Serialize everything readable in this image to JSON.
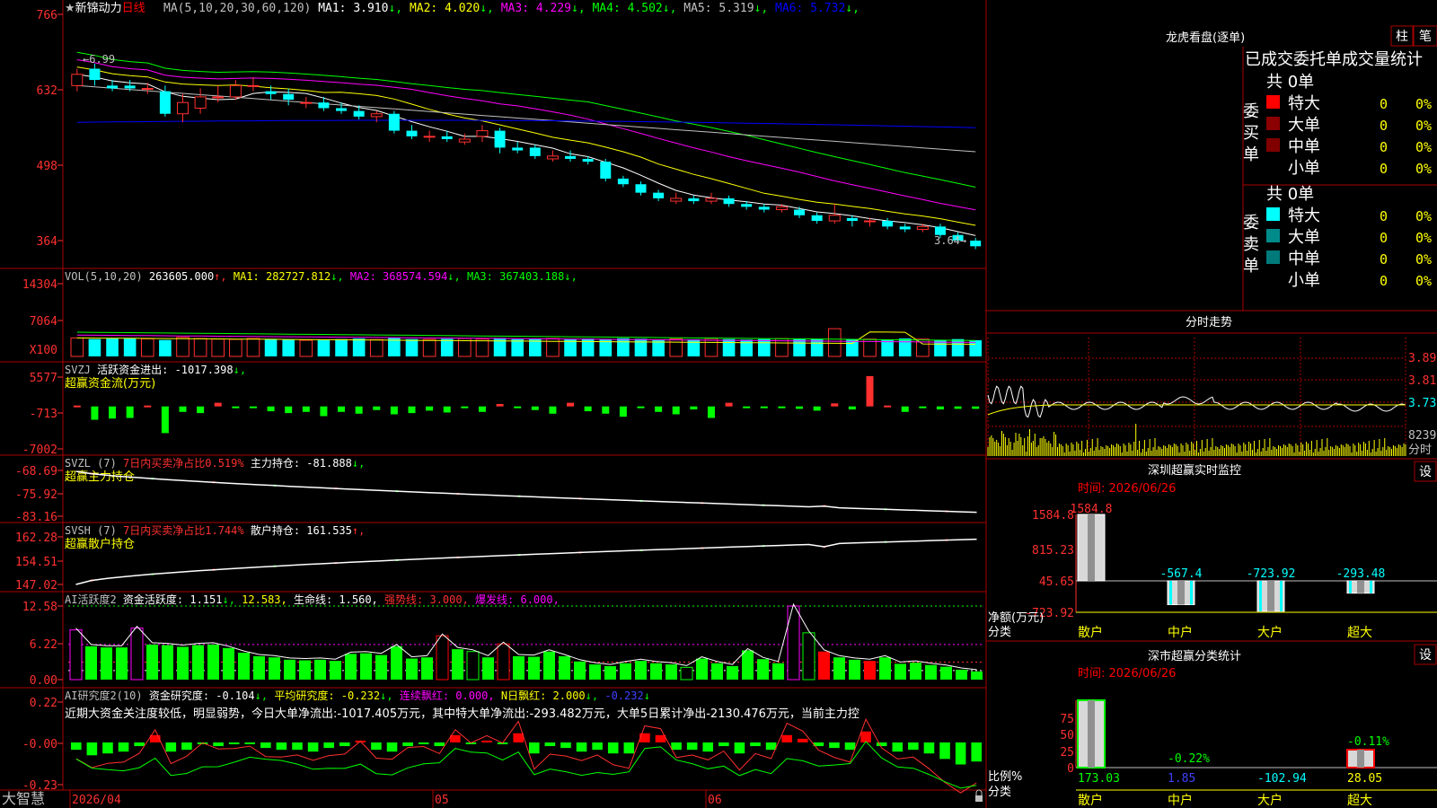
{
  "app": {
    "brand": "大智慧",
    "star": "★",
    "stock_name": "新锦动力",
    "period": "日线"
  },
  "main": {
    "ma_label": "MA(5,10,20,30,60,120)",
    "ma_values": [
      {
        "label": "MA1:",
        "value": "3.910",
        "dir": "↓",
        "color": "#ffffff"
      },
      {
        "label": "MA2:",
        "value": "4.020",
        "dir": "↓",
        "color": "#ffff00"
      },
      {
        "label": "MA3:",
        "value": "4.229",
        "dir": "↓",
        "color": "#ff00ff"
      },
      {
        "label": "MA4:",
        "value": "4.502",
        "dir": "↓",
        "color": "#00ff00"
      },
      {
        "label": "MA5:",
        "value": "5.319",
        "dir": "↓",
        "color": "#c0c0c0"
      },
      {
        "label": "MA6:",
        "value": "5.732",
        "dir": "↓",
        "color": "#0000ff"
      }
    ],
    "y_ticks": [
      "766",
      "632",
      "498",
      "364"
    ],
    "high_marker": "←6.99",
    "low_marker": "3.64→"
  },
  "vol": {
    "label": "VOL(5,10,20)",
    "value": "263605.000",
    "value_dir": "↑",
    "items": [
      {
        "label": "MA1:",
        "value": "282727.812",
        "dir": "↓",
        "color": "#ffff00"
      },
      {
        "label": "MA2:",
        "value": "368574.594",
        "dir": "↓",
        "color": "#ff00ff"
      },
      {
        "label": "MA3:",
        "value": "367403.188",
        "dir": "↓",
        "color": "#00ff00"
      }
    ],
    "y_ticks": [
      "14304",
      "7064"
    ],
    "unit": "X100"
  },
  "svzj": {
    "label": "SVZJ",
    "text1": "活跃资金进出:",
    "value": "-1017.398",
    "value_dir": "↓",
    "subtitle": "超赢资金流(万元)",
    "y_ticks": [
      "5577",
      "-713",
      "-7002"
    ]
  },
  "svzl": {
    "label": "SVZL (7)",
    "text1": "7日内买卖净占比0.519%",
    "text2": "主力持仓:",
    "value": "-81.888",
    "value_dir": "↓",
    "subtitle": "超赢主力持仓",
    "y_ticks": [
      "-68.69",
      "-75.92",
      "-83.16"
    ]
  },
  "svsh": {
    "label": "SVSH (7)",
    "text1": "7日内买卖净占比1.744%",
    "text2": "散户持仓:",
    "value": "161.535",
    "value_dir": "↑",
    "subtitle": "超赢散户持仓",
    "y_ticks": [
      "162.28",
      "154.51",
      "147.02"
    ]
  },
  "ai_active": {
    "label": "AI活跃度2",
    "text1": "资金活跃度:",
    "value1": "1.151",
    "value1_dir": "↓",
    "value2": "12.583",
    "text3": "生命线:",
    "value3": "1.560",
    "text4": "强势线:",
    "value4": "3.000",
    "text5": "爆发线:",
    "value5": "6.000",
    "y_ticks": [
      "12.58",
      "6.22",
      "0.00"
    ]
  },
  "ai_research": {
    "label": "AI研究度2(10)",
    "text1": "资金研究度:",
    "value1": "-0.104",
    "value1_dir": "↓",
    "text2": "平均研究度:",
    "value2": "-0.232",
    "value2_dir": "↓",
    "text3": "连续飘红:",
    "value3": "0.000",
    "text4": "N日飘红:",
    "value4": "2.000",
    "value4_dir": "↓",
    "value5": "-0.232",
    "value5_dir": "↓",
    "comment": "近期大资金关注度较低，明显弱势，今日大单净流出:-1017.405万元，其中特大单净流出:-293.482万元，大单5日累计净出-2130.476万元，当前主力控",
    "y_ticks": [
      "0.22",
      "-0.00",
      "-0.23"
    ]
  },
  "x_axis": {
    "labels": [
      "2026/04",
      "05",
      "06"
    ]
  },
  "lhb": {
    "title": "龙虎看盘(逐单)",
    "btn1": "柱",
    "btn2": "笔",
    "subtitle": "已成交委托单成交量统计",
    "buy_label": "委买单",
    "sell_label": "委卖单",
    "buy_total": "共 0单",
    "sell_total": "共 0单",
    "buy_rows": [
      {
        "name": "特大",
        "count": "0",
        "pct": "0%",
        "color": "#ff0000"
      },
      {
        "name": "大单",
        "count": "0",
        "pct": "0%",
        "color": "#8b0000"
      },
      {
        "name": "中单",
        "count": "0",
        "pct": "0%",
        "color": "#800000"
      },
      {
        "name": "小单",
        "count": "0",
        "pct": "0%",
        "color": ""
      }
    ],
    "sell_rows": [
      {
        "name": "特大",
        "count": "0",
        "pct": "0%",
        "color": "#00ffff"
      },
      {
        "name": "大单",
        "count": "0",
        "pct": "0%",
        "color": "#008b8b"
      },
      {
        "name": "中单",
        "count": "0",
        "pct": "0%",
        "color": "#007a7a"
      },
      {
        "name": "小单",
        "count": "0",
        "pct": "0%",
        "color": ""
      }
    ]
  },
  "fenshi": {
    "title": "分时走势",
    "price_ticks": [
      "3.890",
      "3.810",
      "3.730"
    ],
    "vol_tick": "8239",
    "unit": "分时"
  },
  "sz_monitor": {
    "title": "深圳超赢实时监控",
    "btn": "设",
    "time": "时间: 2026/06/26",
    "y_ticks": [
      "1584.8",
      "815.23",
      "45.65",
      "-723.92"
    ],
    "axis_label1": "净额(万元)",
    "axis_label2": "分类",
    "bars": [
      {
        "name": "散户",
        "value": 1584.8,
        "label": "1584.8"
      },
      {
        "name": "中户",
        "value": -567.4,
        "label": "-567.4"
      },
      {
        "name": "大户",
        "value": -723.92,
        "label": "-723.92"
      },
      {
        "name": "超大",
        "value": -293.48,
        "label": "-293.48"
      }
    ]
  },
  "sz_class": {
    "title": "深市超赢分类统计",
    "btn": "设",
    "time": "时间: 2026/06/26",
    "y_ticks": [
      "75",
      "50",
      "25",
      "0"
    ],
    "axis_label1": "比例%",
    "axis_label2": "分类",
    "bars": [
      {
        "name": "散户",
        "value": 75,
        "top_label": "",
        "bottom_label": "173.03",
        "bottom_color": "#00ff00"
      },
      {
        "name": "中户",
        "value": 0,
        "top_label": "-0.22%",
        "bottom_label": "1.85",
        "bottom_color": "#4040ff"
      },
      {
        "name": "大户",
        "value": 0,
        "top_label": "",
        "bottom_label": "-102.94",
        "bottom_color": "#00ffff"
      },
      {
        "name": "超大",
        "value": 20,
        "top_label": "-0.11%",
        "bottom_label": "28.05",
        "bottom_color": "#ffff00"
      }
    ]
  },
  "chart_data": [
    {
      "type": "candlestick",
      "title": "新锦动力 日线",
      "x_labels": [
        "2026/04",
        "05",
        "06"
      ],
      "ylim": [
        3.5,
        7.8
      ],
      "note": "price axis labels printed as 766/632/498/364 (x0.01 yuan)",
      "candles": [
        [
          6.6,
          6.8,
          6.9,
          6.5
        ],
        [
          6.9,
          6.7,
          6.99,
          6.6
        ],
        [
          6.6,
          6.55,
          6.7,
          6.5
        ],
        [
          6.6,
          6.55,
          6.7,
          6.5
        ],
        [
          6.55,
          6.55,
          6.65,
          6.45
        ],
        [
          6.5,
          6.1,
          6.6,
          6.05
        ],
        [
          6.1,
          6.3,
          6.45,
          5.95
        ],
        [
          6.2,
          6.4,
          6.55,
          6.1
        ],
        [
          6.4,
          6.4,
          6.6,
          6.3
        ],
        [
          6.4,
          6.6,
          6.7,
          6.35
        ],
        [
          6.6,
          6.6,
          6.75,
          6.5
        ],
        [
          6.5,
          6.45,
          6.6,
          6.35
        ],
        [
          6.45,
          6.35,
          6.55,
          6.25
        ],
        [
          6.3,
          6.3,
          6.4,
          6.2
        ],
        [
          6.3,
          6.2,
          6.4,
          6.15
        ],
        [
          6.2,
          6.15,
          6.3,
          6.1
        ],
        [
          6.15,
          6.05,
          6.25,
          6.0
        ],
        [
          6.05,
          6.1,
          6.15,
          5.95
        ],
        [
          6.1,
          5.8,
          6.15,
          5.75
        ],
        [
          5.8,
          5.7,
          5.9,
          5.65
        ],
        [
          5.7,
          5.7,
          5.8,
          5.6
        ],
        [
          5.7,
          5.65,
          5.8,
          5.6
        ],
        [
          5.6,
          5.65,
          5.75,
          5.55
        ],
        [
          5.7,
          5.8,
          5.9,
          5.6
        ],
        [
          5.8,
          5.5,
          5.85,
          5.4
        ],
        [
          5.5,
          5.45,
          5.6,
          5.4
        ],
        [
          5.5,
          5.35,
          5.55,
          5.3
        ],
        [
          5.3,
          5.35,
          5.45,
          5.25
        ],
        [
          5.35,
          5.3,
          5.45,
          5.25
        ],
        [
          5.3,
          5.25,
          5.35,
          5.2
        ],
        [
          5.25,
          4.95,
          5.3,
          4.9
        ],
        [
          4.95,
          4.85,
          5.0,
          4.8
        ],
        [
          4.85,
          4.7,
          4.9,
          4.65
        ],
        [
          4.7,
          4.6,
          4.75,
          4.55
        ],
        [
          4.55,
          4.6,
          4.7,
          4.5
        ],
        [
          4.6,
          4.55,
          4.65,
          4.5
        ],
        [
          4.55,
          4.6,
          4.7,
          4.5
        ],
        [
          4.6,
          4.5,
          4.65,
          4.45
        ],
        [
          4.5,
          4.45,
          4.55,
          4.4
        ],
        [
          4.45,
          4.4,
          4.5,
          4.35
        ],
        [
          4.4,
          4.45,
          4.5,
          4.35
        ],
        [
          4.4,
          4.3,
          4.45,
          4.25
        ],
        [
          4.3,
          4.2,
          4.35,
          4.15
        ],
        [
          4.2,
          4.3,
          4.5,
          4.15
        ],
        [
          4.25,
          4.2,
          4.3,
          4.1
        ],
        [
          4.2,
          4.2,
          4.25,
          4.1
        ],
        [
          4.2,
          4.1,
          4.25,
          4.05
        ],
        [
          4.1,
          4.05,
          4.15,
          4.0
        ],
        [
          4.05,
          4.1,
          4.15,
          4.0
        ],
        [
          4.1,
          3.95,
          4.15,
          3.9
        ],
        [
          3.95,
          3.85,
          4.0,
          3.8
        ],
        [
          3.85,
          3.75,
          3.9,
          3.7
        ]
      ],
      "series": [
        {
          "name": "MA1",
          "color": "#ffffff"
        },
        {
          "name": "MA2",
          "color": "#ffff00"
        },
        {
          "name": "MA3",
          "color": "#ff00ff"
        },
        {
          "name": "MA4",
          "color": "#00ff00"
        },
        {
          "name": "MA5",
          "color": "#c0c0c0"
        },
        {
          "name": "MA6",
          "color": "#0000ff"
        }
      ]
    },
    {
      "type": "bar",
      "title": "VOL(5,10,20)",
      "unit": "X100",
      "ylim": [
        0,
        14304
      ],
      "values": [
        3200,
        3000,
        3100,
        3150,
        3050,
        2850,
        3300,
        3100,
        3000,
        2950,
        3100,
        3050,
        2900,
        2800,
        2900,
        3000,
        3100,
        2900,
        3200,
        3000,
        2950,
        3050,
        3100,
        3000,
        3200,
        3000,
        3050,
        3100,
        2950,
        3100,
        3000,
        3150,
        3050,
        2900,
        3050,
        2950,
        3100,
        3000,
        2900,
        3000,
        3100,
        3000,
        3000,
        4800,
        3000,
        3000,
        2950,
        3100,
        3000,
        2800,
        3000,
        2800
      ]
    },
    {
      "type": "bar",
      "title": "超赢资金流(万元)",
      "ylim": [
        -7002,
        5577
      ],
      "values": [
        0,
        -2200,
        -2000,
        -1900,
        0,
        -4400,
        -900,
        -1100,
        600,
        -300,
        -200,
        -800,
        -1100,
        -900,
        -1600,
        -900,
        -1200,
        -600,
        -1300,
        -1100,
        -700,
        -1000,
        -300,
        -900,
        400,
        -200,
        -600,
        -1200,
        600,
        -800,
        -1200,
        -1700,
        -200,
        -900,
        -1300,
        -500,
        -1900,
        600,
        -200,
        -200,
        -300,
        -400,
        -700,
        500,
        -500,
        5000,
        0,
        -900,
        -300,
        -500,
        -400,
        -400
      ]
    },
    {
      "type": "line",
      "title": "超赢主力持仓",
      "ylim": [
        -83.16,
        -68.69
      ],
      "y_end": -81.888
    },
    {
      "type": "line",
      "title": "超赢散户持仓",
      "ylim": [
        147.02,
        162.28
      ],
      "y_end": 161.535
    },
    {
      "type": "bar",
      "title": "AI活跃度2",
      "ylim": [
        0,
        12.58
      ],
      "reference_lines": [
        1.56,
        3.0,
        6.0
      ],
      "values": [
        8.5,
        5.7,
        5.5,
        5.5,
        8.8,
        6.0,
        5.9,
        5.6,
        5.9,
        6.0,
        5.4,
        4.6,
        4.0,
        3.8,
        3.4,
        3.3,
        3.4,
        3.2,
        4.4,
        4.5,
        4.2,
        5.7,
        3.6,
        3.8,
        7.5,
        5.2,
        4.8,
        3.8,
        6.1,
        4.0,
        3.9,
        4.8,
        4.0,
        3.1,
        2.6,
        2.3,
        2.8,
        3.2,
        2.8,
        2.6,
        2.1,
        3.6,
        2.8,
        2.3,
        5.0,
        3.5,
        2.8,
        12.58,
        8.0,
        4.8,
        3.8,
        3.4,
        3.2,
        3.8,
        2.7,
        2.9,
        2.5,
        2.2,
        1.7,
        1.4
      ]
    },
    {
      "type": "bar",
      "title": "AI研究度2(10)",
      "ylim": [
        -0.23,
        0.22
      ],
      "values": [
        -0.04,
        -0.07,
        -0.06,
        -0.05,
        -0.02,
        0.04,
        -0.05,
        -0.04,
        -0.01,
        -0.02,
        -0.01,
        0.0,
        -0.03,
        -0.04,
        -0.04,
        -0.05,
        -0.03,
        -0.02,
        0.01,
        -0.04,
        -0.05,
        -0.02,
        -0.01,
        -0.02,
        0.04,
        0.0,
        0.01,
        -0.01,
        0.05,
        -0.06,
        -0.02,
        -0.03,
        -0.05,
        -0.04,
        -0.06,
        -0.06,
        0.05,
        0.04,
        -0.04,
        -0.04,
        -0.05,
        -0.02,
        -0.06,
        -0.02,
        -0.04,
        0.04,
        0.02,
        -0.02,
        -0.03,
        -0.04,
        0.06,
        -0.02,
        -0.05,
        -0.04,
        -0.06,
        -0.09,
        -0.12,
        -0.104
      ],
      "average_line": -0.232
    },
    {
      "type": "bar",
      "title": "深圳超赢实时监控",
      "categories": [
        "散户",
        "中户",
        "大户",
        "超大"
      ],
      "values": [
        1584.8,
        -567.4,
        -723.92,
        -293.48
      ],
      "ylim": [
        -723.92,
        1584.8
      ]
    },
    {
      "type": "bar",
      "title": "深市超赢分类统计",
      "categories": [
        "散户",
        "中户",
        "大户",
        "超大"
      ],
      "values": [
        173.03,
        1.85,
        -102.94,
        28.05
      ],
      "ylim": [
        0,
        75
      ]
    }
  ]
}
